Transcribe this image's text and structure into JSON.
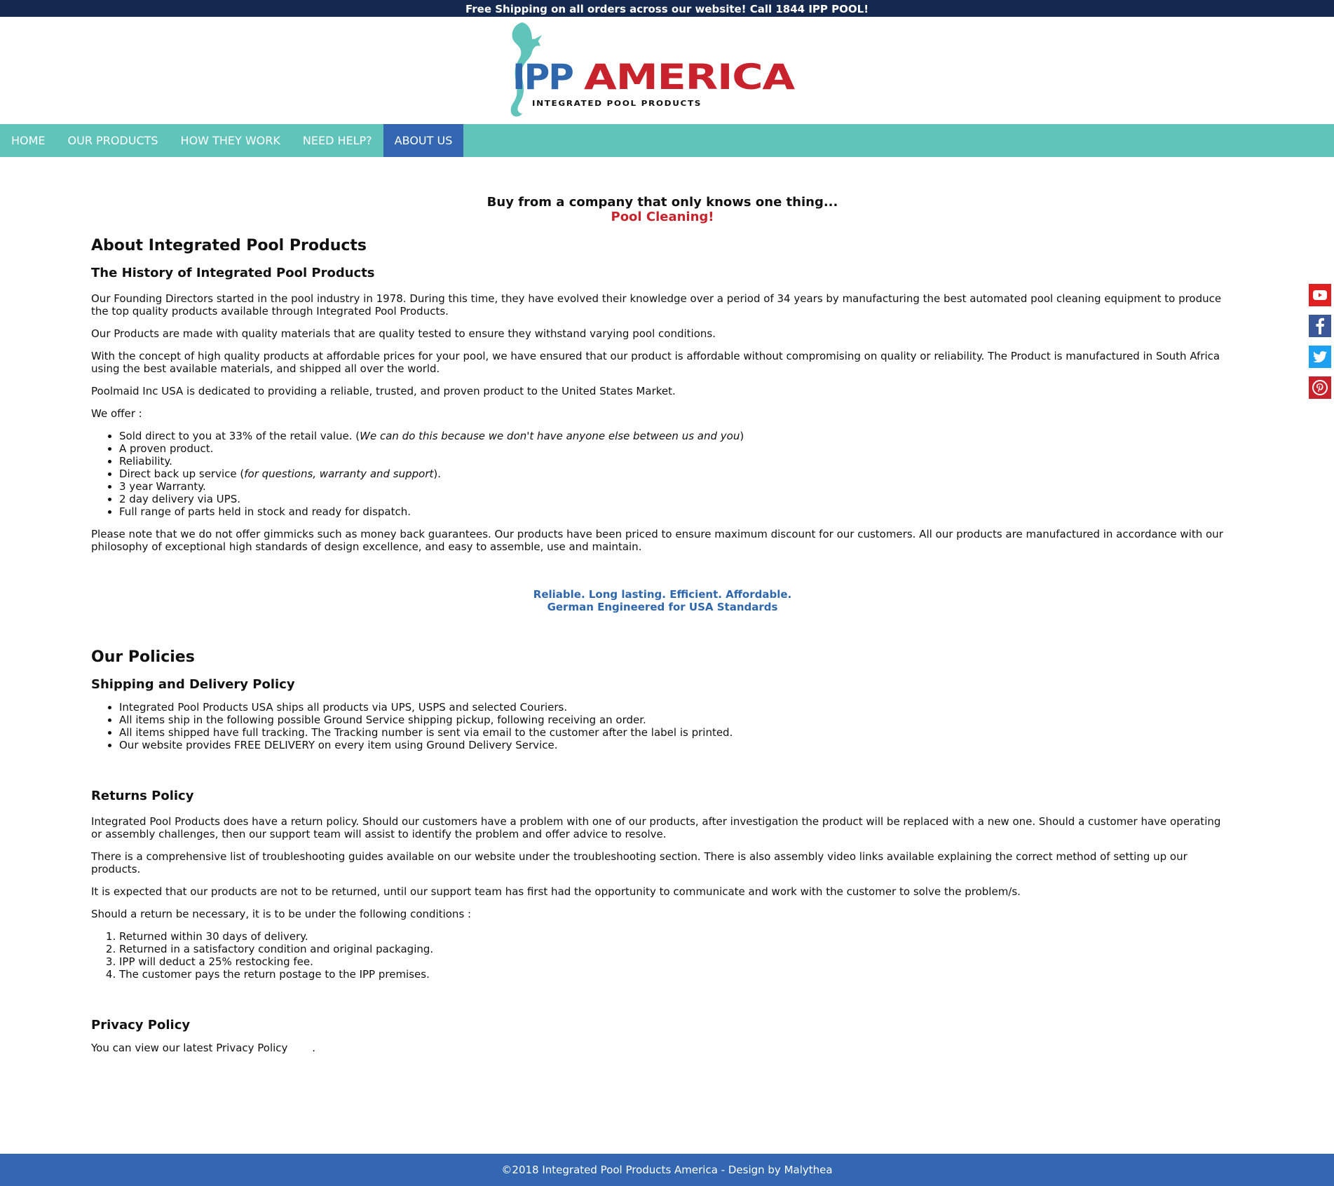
{
  "topbar": {
    "text": "Free Shipping on all orders across our website! Call 1844 IPP POOL!"
  },
  "logo": {
    "name": "IPP AMERICA",
    "brand_left": "IPP",
    "brand_right": "AMERICA",
    "subtitle": "INTEGRATED POOL PRODUCTS",
    "colors": {
      "blue": "#2f67ad",
      "red": "#c8232c",
      "teal": "#61c4ba"
    }
  },
  "nav": {
    "items": [
      "HOME",
      "OUR PRODUCTS",
      "HOW THEY WORK",
      "NEED HELP?",
      "ABOUT US"
    ],
    "active": "ABOUT US",
    "colors": {
      "bar": "#61c4ba",
      "active": "#3367b2"
    }
  },
  "tagline": {
    "line1": "Buy from a company that only knows one thing...",
    "line2": "Pool Cleaning!"
  },
  "about": {
    "title": "About Integrated Pool Products",
    "history_title": "The History of Integrated Pool Products",
    "paragraphs": [
      "Our Founding Directors started in the pool industry in 1978. During this time, they have evolved their knowledge over a period of 34 years by manufacturing the best automated pool cleaning equipment to produce the top quality products available through Integrated Pool Products.",
      "Our Products are made with quality materials that are quality tested to ensure they withstand varying pool conditions.",
      "With the concept of high quality products at affordable prices for your pool, we have ensured that our product is affordable without compromising on quality or reliability. The Product is manufactured in South Africa using the best available materials, and shipped all over the world.",
      "Poolmaid Inc USA is dedicated to providing a reliable, trusted, and proven product to the United States Market.",
      "We offer :"
    ],
    "offer_items": [
      {
        "text": "Sold direct to you at 33% of the retail value. (",
        "em": "We can do this because we don't have anyone else between us and you",
        "after": ")"
      },
      {
        "text": "A proven product.",
        "em": "",
        "after": ""
      },
      {
        "text": "Reliability.",
        "em": "",
        "after": ""
      },
      {
        "text": "Direct back up service (",
        "em": "for questions, warranty and support",
        "after": ")."
      },
      {
        "text": "3 year Warranty.",
        "em": "",
        "after": ""
      },
      {
        "text": "2 day delivery via UPS.",
        "em": "",
        "after": ""
      },
      {
        "text": "Full range of parts held in stock and ready for dispatch.",
        "em": "",
        "after": ""
      }
    ],
    "note": "Please note that we do not offer gimmicks such as money back guarantees. Our products have been priced to ensure maximum discount for our customers. All our products are manufactured in accordance with our philosophy of exceptional high standards of design excellence, and easy to assemble, use and maintain.",
    "slogan1": "Reliable. Long lasting. Efficient. Affordable.",
    "slogan2": "German Engineered for USA Standards"
  },
  "policies": {
    "title": "Our Policies",
    "shipping_title": "Shipping and Delivery Policy",
    "shipping_items": [
      "Integrated Pool Products USA ships all products via UPS, USPS and selected Couriers.",
      "All items ship in the following possible Ground Service shipping pickup, following receiving an order.",
      "All items shipped have full tracking. The Tracking number is sent via email to the customer after the label is printed.",
      "Our website provides FREE DELIVERY on every item using Ground Delivery Service."
    ],
    "returns_title": "Returns Policy",
    "returns_paragraphs": [
      "Integrated Pool Products does have a return policy. Should our customers have a problem with one of our products, after investigation the product will be replaced with a new one. Should a customer have operating or assembly challenges, then our support team will assist to identify the problem and offer advice to resolve.",
      "There is a comprehensive list of troubleshooting guides available on our website under the troubleshooting section. There is also assembly video links available explaining the correct method of setting up our products.",
      "It is expected that our products are not to be returned, until our support team has first had the opportunity to communicate and work with the customer to solve the problem/s.",
      "Should a return be necessary, it is to be under the following conditions :"
    ],
    "returns_conditions": [
      "Returned within 30 days of delivery.",
      "Returned in a satisfactory condition and original packaging.",
      "IPP will deduct a 25% restocking fee.",
      "The customer pays the return postage to the IPP premises."
    ],
    "privacy_title": "Privacy Policy",
    "privacy_text": "You can view our latest Privacy Policy",
    "privacy_link": "",
    "privacy_end": "."
  },
  "social": {
    "icons": [
      "youtube-icon",
      "facebook-icon",
      "twitter-icon",
      "pinterest-icon"
    ]
  },
  "footer": {
    "text": "©2018 Integrated Pool Products America - Design by Malythea"
  }
}
